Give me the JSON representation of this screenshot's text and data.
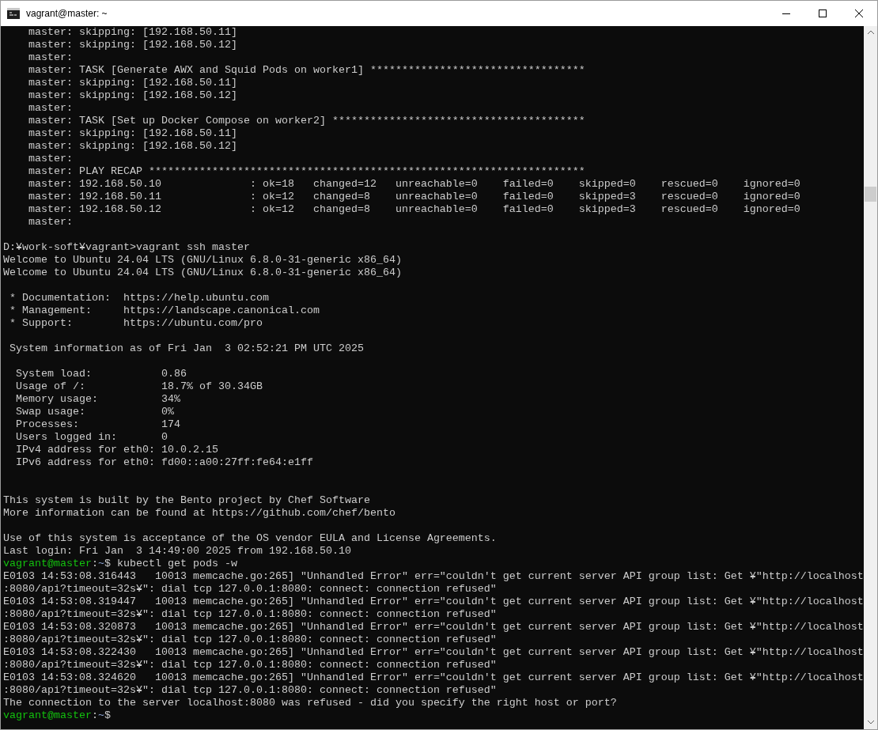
{
  "window": {
    "title": "vagrant@master: ~"
  },
  "terminal": {
    "lines": [
      {
        "kind": "text",
        "text": "    master: skipping: [192.168.50.11]"
      },
      {
        "kind": "text",
        "text": "    master: skipping: [192.168.50.12]"
      },
      {
        "kind": "text",
        "text": "    master:"
      },
      {
        "kind": "text",
        "text": "    master: TASK [Generate AWX and Squid Pods on worker1] **********************************"
      },
      {
        "kind": "text",
        "text": "    master: skipping: [192.168.50.11]"
      },
      {
        "kind": "text",
        "text": "    master: skipping: [192.168.50.12]"
      },
      {
        "kind": "text",
        "text": "    master:"
      },
      {
        "kind": "text",
        "text": "    master: TASK [Set up Docker Compose on worker2] ****************************************"
      },
      {
        "kind": "text",
        "text": "    master: skipping: [192.168.50.11]"
      },
      {
        "kind": "text",
        "text": "    master: skipping: [192.168.50.12]"
      },
      {
        "kind": "text",
        "text": "    master:"
      },
      {
        "kind": "text",
        "text": "    master: PLAY RECAP *********************************************************************"
      },
      {
        "kind": "text",
        "text": "    master: 192.168.50.10              : ok=18   changed=12   unreachable=0    failed=0    skipped=0    rescued=0    ignored=0"
      },
      {
        "kind": "text",
        "text": "    master: 192.168.50.11              : ok=12   changed=8    unreachable=0    failed=0    skipped=3    rescued=0    ignored=0"
      },
      {
        "kind": "text",
        "text": "    master: 192.168.50.12              : ok=12   changed=8    unreachable=0    failed=0    skipped=3    rescued=0    ignored=0"
      },
      {
        "kind": "text",
        "text": "    master:"
      },
      {
        "kind": "blank"
      },
      {
        "kind": "text",
        "text": "D:¥work-soft¥vagrant>vagrant ssh master"
      },
      {
        "kind": "text",
        "text": "Welcome to Ubuntu 24.04 LTS (GNU/Linux 6.8.0-31-generic x86_64)"
      },
      {
        "kind": "text",
        "text": "Welcome to Ubuntu 24.04 LTS (GNU/Linux 6.8.0-31-generic x86_64)"
      },
      {
        "kind": "blank"
      },
      {
        "kind": "text",
        "text": " * Documentation:  https://help.ubuntu.com"
      },
      {
        "kind": "text",
        "text": " * Management:     https://landscape.canonical.com"
      },
      {
        "kind": "text",
        "text": " * Support:        https://ubuntu.com/pro"
      },
      {
        "kind": "blank"
      },
      {
        "kind": "text",
        "text": " System information as of Fri Jan  3 02:52:21 PM UTC 2025"
      },
      {
        "kind": "blank"
      },
      {
        "kind": "text",
        "text": "  System load:           0.86"
      },
      {
        "kind": "text",
        "text": "  Usage of /:            18.7% of 30.34GB"
      },
      {
        "kind": "text",
        "text": "  Memory usage:          34%"
      },
      {
        "kind": "text",
        "text": "  Swap usage:            0%"
      },
      {
        "kind": "text",
        "text": "  Processes:             174"
      },
      {
        "kind": "text",
        "text": "  Users logged in:       0"
      },
      {
        "kind": "text",
        "text": "  IPv4 address for eth0: 10.0.2.15"
      },
      {
        "kind": "text",
        "text": "  IPv6 address for eth0: fd00::a00:27ff:fe64:e1ff"
      },
      {
        "kind": "blank"
      },
      {
        "kind": "blank"
      },
      {
        "kind": "text",
        "text": "This system is built by the Bento project by Chef Software"
      },
      {
        "kind": "text",
        "text": "More information can be found at https://github.com/chef/bento"
      },
      {
        "kind": "blank"
      },
      {
        "kind": "text",
        "text": "Use of this system is acceptance of the OS vendor EULA and License Agreements."
      },
      {
        "kind": "text",
        "text": "Last login: Fri Jan  3 14:49:00 2025 from 192.168.50.10"
      },
      {
        "kind": "prompt",
        "user": "vagrant@master",
        "separator": ":",
        "path": "~",
        "symbol": "$",
        "command": " kubectl get pods -w"
      },
      {
        "kind": "text",
        "text": "E0103 14:53:08.316443   10013 memcache.go:265] \"Unhandled Error\" err=\"couldn't get current server API group list: Get ¥\"http://localhost"
      },
      {
        "kind": "text",
        "text": ":8080/api?timeout=32s¥\": dial tcp 127.0.0.1:8080: connect: connection refused\""
      },
      {
        "kind": "text",
        "text": "E0103 14:53:08.319447   10013 memcache.go:265] \"Unhandled Error\" err=\"couldn't get current server API group list: Get ¥\"http://localhost"
      },
      {
        "kind": "text",
        "text": ":8080/api?timeout=32s¥\": dial tcp 127.0.0.1:8080: connect: connection refused\""
      },
      {
        "kind": "text",
        "text": "E0103 14:53:08.320873   10013 memcache.go:265] \"Unhandled Error\" err=\"couldn't get current server API group list: Get ¥\"http://localhost"
      },
      {
        "kind": "text",
        "text": ":8080/api?timeout=32s¥\": dial tcp 127.0.0.1:8080: connect: connection refused\""
      },
      {
        "kind": "text",
        "text": "E0103 14:53:08.322430   10013 memcache.go:265] \"Unhandled Error\" err=\"couldn't get current server API group list: Get ¥\"http://localhost"
      },
      {
        "kind": "text",
        "text": ":8080/api?timeout=32s¥\": dial tcp 127.0.0.1:8080: connect: connection refused\""
      },
      {
        "kind": "text",
        "text": "E0103 14:53:08.324620   10013 memcache.go:265] \"Unhandled Error\" err=\"couldn't get current server API group list: Get ¥\"http://localhost"
      },
      {
        "kind": "text",
        "text": ":8080/api?timeout=32s¥\": dial tcp 127.0.0.1:8080: connect: connection refused\""
      },
      {
        "kind": "text",
        "text": "The connection to the server localhost:8080 was refused - did you specify the right host or port?"
      },
      {
        "kind": "prompt",
        "user": "vagrant@master",
        "separator": ":",
        "path": "~",
        "symbol": "$"
      }
    ]
  }
}
